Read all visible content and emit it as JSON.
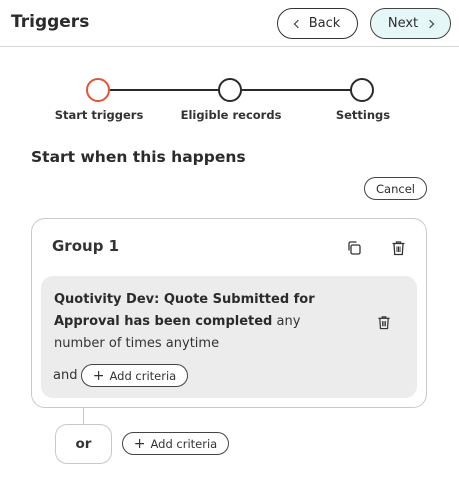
{
  "header": {
    "title": "Triggers",
    "back_label": "Back",
    "next_label": "Next"
  },
  "stepper": {
    "steps": [
      {
        "label": "Start triggers",
        "state": "active"
      },
      {
        "label": "Eligible records",
        "state": "upcoming"
      },
      {
        "label": "Settings",
        "state": "upcoming"
      }
    ]
  },
  "main": {
    "section_title": "Start when this happens",
    "cancel_label": "Cancel"
  },
  "group": {
    "title": "Group 1",
    "icons": [
      "copy-icon",
      "trash-icon"
    ],
    "criteria": {
      "bold_text": "Quotivity Dev: Quote Submitted for Approval has been completed",
      "rest_text": " any number of times anytime",
      "and_label": "and",
      "add_criteria_label": "Add criteria"
    }
  },
  "footer": {
    "or_label": "or",
    "add_criteria_label": "Add criteria"
  },
  "colors": {
    "active_step": "#e0543a",
    "next_button_bg": "#e6f7f7",
    "criteria_bg": "#ececec"
  }
}
